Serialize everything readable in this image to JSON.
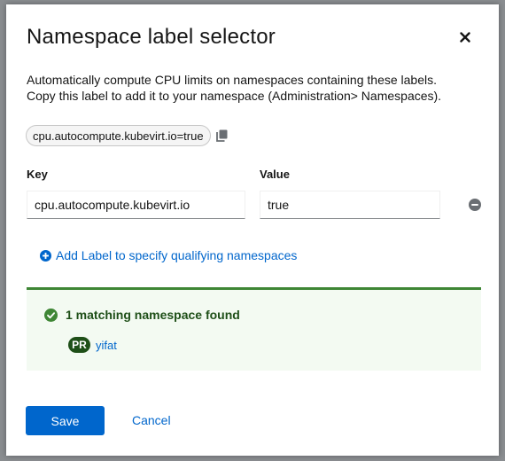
{
  "modal": {
    "title": "Namespace label selector",
    "close_icon": "close-icon",
    "description_line1": "Automatically compute CPU limits on namespaces containing these labels.",
    "description_line2": "Copy this label to add it to your namespace (Administration> Namespaces).",
    "label_chip": "cpu.autocompute.kubevirt.io=true",
    "copy_icon": "copy-icon"
  },
  "form": {
    "key_label": "Key",
    "value_label": "Value",
    "key_value": "cpu.autocompute.kubevirt.io",
    "value_value": "true",
    "remove_icon": "minus-circle-icon",
    "add_label_text": "Add Label to specify qualifying namespaces",
    "add_icon": "plus-circle-icon"
  },
  "alert": {
    "title": "1 matching namespace found",
    "status_icon": "check-circle-icon",
    "namespaces": [
      {
        "badge": "PR",
        "name": "yifat"
      }
    ],
    "colors": {
      "success": "#3e8635",
      "background": "#f3faf2"
    }
  },
  "footer": {
    "save_label": "Save",
    "cancel_label": "Cancel"
  },
  "colors": {
    "primary": "#0066cc"
  }
}
